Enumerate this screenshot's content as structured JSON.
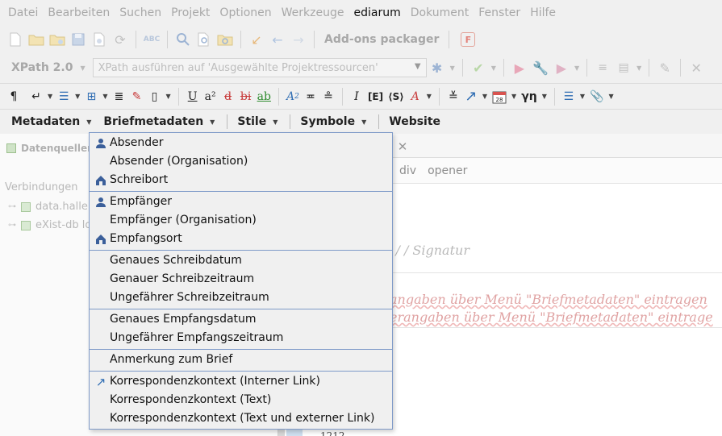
{
  "menubar": [
    "Datei",
    "Bearbeiten",
    "Suchen",
    "Projekt",
    "Optionen",
    "Werkzeuge",
    "ediarum",
    "Dokument",
    "Fenster",
    "Hilfe"
  ],
  "toolbar1": {
    "addons_label": "Add-ons packager",
    "f_label": "F"
  },
  "toolbar2": {
    "xpath_label": "XPath 2.0",
    "xpath_placeholder": "XPath ausführen auf  'Ausgewählte Projektressourcen'"
  },
  "toolbar3": {
    "pilcrow": "¶",
    "enter": "↵",
    "list": "☰",
    "table": "⊞",
    "underline": "U",
    "superscript": "a²",
    "strike1": "d",
    "strike2": "bi",
    "ab": "ab",
    "italic": "I",
    "e_tag": "[E]",
    "s_tag": "⟨S⟩",
    "date_num": "28",
    "gamma": "γη",
    "arrow": "↗",
    "clip": "📎"
  },
  "ediarum_bar": {
    "items": [
      "Metadaten",
      "Briefmetadaten",
      "Stile",
      "Symbole",
      "Website"
    ]
  },
  "left_panel": {
    "tab_label": "Datenquellen",
    "heading": "Verbindungen",
    "items": [
      "data.halle",
      "eXist-db lo"
    ]
  },
  "editor": {
    "breadcrumbs": [
      "div",
      "opener"
    ],
    "line1": ": / / Signatur",
    "line2": "angaben über Menü \"Briefmetadaten\" eintragen",
    "line3": "erangaben über Menü \"Briefmetadaten\" eintrage",
    "tail": "1212"
  },
  "dropdown": {
    "items": [
      "Absender",
      "Absender (Organisation)",
      "Schreibort",
      "Empfänger",
      "Empfänger (Organisation)",
      "Empfangsort",
      "Genaues Schreibdatum",
      "Genauer Schreibzeitraum",
      "Ungefährer Schreibzeitraum",
      "Genaues Empfangsdatum",
      "Ungefährer Empfangszeitraum",
      "Anmerkung zum Brief",
      "Korrespondenzkontext (Interner Link)",
      "Korrespondenzkontext (Text)",
      "Korrespondenzkontext (Text und externer Link)"
    ]
  },
  "colors": {
    "menu_border": "#7e9ac8",
    "icon_blue": "#3b5f9a",
    "link_blue": "#2f6db3",
    "spell_red": "#e0a3a3"
  }
}
